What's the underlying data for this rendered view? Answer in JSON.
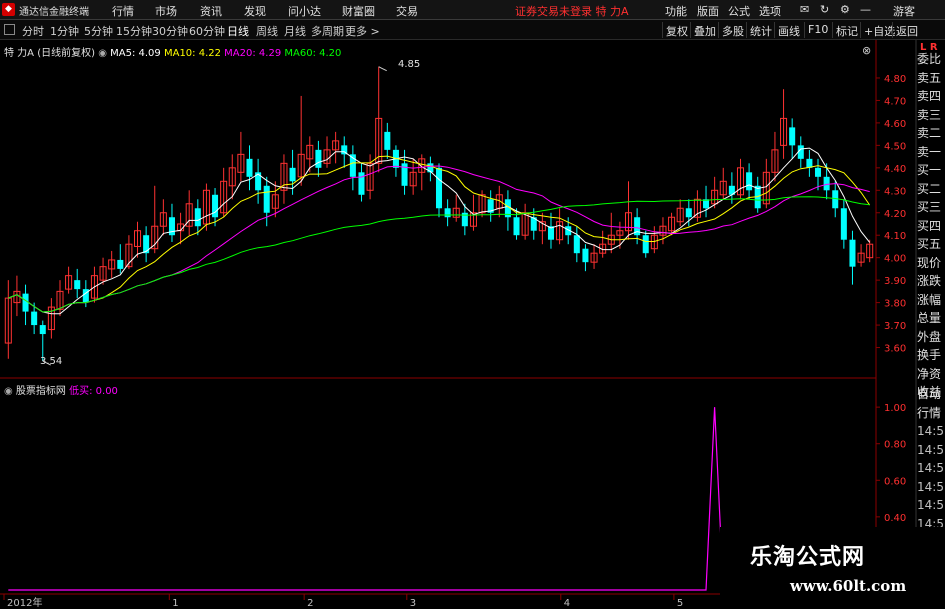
{
  "app": {
    "title": "通达信金融终端",
    "menu": [
      "行情",
      "市场",
      "资讯",
      "发现",
      "问小达",
      "财富圈",
      "交易"
    ],
    "login_status": "证券交易未登录",
    "stock_short": "特 力A",
    "right_menu": [
      "功能",
      "版面",
      "公式",
      "选项"
    ],
    "guest": "游客"
  },
  "periodbar": {
    "periods": [
      "分时",
      "1分钟",
      "5分钟",
      "15分钟",
      "30分钟",
      "60分钟",
      "日线",
      "周线",
      "月线",
      "多周期",
      "更多 >"
    ],
    "active_period": "日线",
    "tools": [
      "复权",
      "叠加",
      "多股",
      "统计",
      "画线",
      "F10",
      "标记",
      "+自选",
      "返回"
    ]
  },
  "legend_main": {
    "stock": "特 力A (日线前复权)",
    "ma5": "MA5: 4.09",
    "ma10": "MA10: 4.22",
    "ma20": "MA20: 4.29",
    "ma60": "MA60: 4.20"
  },
  "legend_sub": {
    "name": "股票指标网",
    "indicator": "低买: 0.00"
  },
  "annotations": {
    "high": "4.85",
    "low": "3.54"
  },
  "price_axis": [
    "4.80",
    "4.70",
    "4.60",
    "4.50",
    "4.40",
    "4.30",
    "4.20",
    "4.10",
    "4.00",
    "3.90",
    "3.80",
    "3.70",
    "3.60"
  ],
  "sub_axis": [
    "1.00",
    "0.80",
    "0.60",
    "0.40"
  ],
  "time_axis": [
    "2012年",
    "1",
    "2",
    "3",
    "4",
    "5"
  ],
  "side_panel": [
    "委比",
    "卖五",
    "卖四",
    "卖三",
    "卖二",
    "卖一",
    "买一",
    "买二",
    "买三",
    "买四",
    "买五",
    "现价",
    "涨跌",
    "涨幅",
    "总量",
    "外盘",
    "换手",
    "净资",
    "收益"
  ],
  "side_panel2": [
    "自动",
    "行情",
    "14:5",
    "14:5",
    "14:5",
    "14:5",
    "14:5",
    "14:5"
  ],
  "side_top": "L R",
  "watermark": {
    "line1": "乐淘公式网",
    "line2": "www.60lt.com"
  },
  "colors": {
    "up": "#ff3232",
    "down": "#00ffff",
    "ma5": "#ffffff",
    "ma10": "#ffff00",
    "ma20": "#ff00ff",
    "ma60": "#00ff00",
    "signal": "#ff00ff"
  },
  "chart_data": {
    "type": "candlestick",
    "price_range": [
      3.5,
      4.88
    ],
    "candles": [
      [
        3.62,
        3.82,
        3.9,
        3.55
      ],
      [
        3.8,
        3.85,
        3.92,
        3.74
      ],
      [
        3.84,
        3.76,
        3.88,
        3.7
      ],
      [
        3.76,
        3.7,
        3.8,
        3.66
      ],
      [
        3.7,
        3.66,
        3.72,
        3.54
      ],
      [
        3.68,
        3.78,
        3.82,
        3.64
      ],
      [
        3.77,
        3.85,
        3.9,
        3.74
      ],
      [
        3.86,
        3.92,
        3.96,
        3.84
      ],
      [
        3.9,
        3.86,
        3.95,
        3.82
      ],
      [
        3.86,
        3.8,
        3.9,
        3.78
      ],
      [
        3.82,
        3.92,
        3.96,
        3.8
      ],
      [
        3.9,
        3.96,
        4.0,
        3.88
      ],
      [
        3.95,
        3.99,
        4.03,
        3.91
      ],
      [
        3.99,
        3.95,
        4.06,
        3.93
      ],
      [
        3.96,
        4.06,
        4.1,
        3.95
      ],
      [
        4.05,
        4.12,
        4.16,
        4.0
      ],
      [
        4.1,
        4.02,
        4.14,
        3.98
      ],
      [
        4.04,
        4.14,
        4.32,
        4.02
      ],
      [
        4.14,
        4.2,
        4.26,
        4.1
      ],
      [
        4.18,
        4.1,
        4.24,
        4.07
      ],
      [
        4.12,
        4.15,
        4.2,
        4.06
      ],
      [
        4.14,
        4.24,
        4.3,
        4.1
      ],
      [
        4.22,
        4.14,
        4.26,
        4.1
      ],
      [
        4.15,
        4.3,
        4.33,
        4.12
      ],
      [
        4.28,
        4.18,
        4.31,
        4.14
      ],
      [
        4.2,
        4.34,
        4.4,
        4.18
      ],
      [
        4.32,
        4.4,
        4.46,
        4.26
      ],
      [
        4.38,
        4.46,
        4.56,
        4.34
      ],
      [
        4.44,
        4.36,
        4.5,
        4.3
      ],
      [
        4.38,
        4.3,
        4.44,
        4.24
      ],
      [
        4.32,
        4.2,
        4.36,
        4.14
      ],
      [
        4.22,
        4.28,
        4.34,
        4.18
      ],
      [
        4.3,
        4.42,
        4.46,
        4.24
      ],
      [
        4.4,
        4.34,
        4.48,
        4.28
      ],
      [
        4.36,
        4.46,
        4.72,
        4.32
      ],
      [
        4.44,
        4.5,
        4.54,
        4.38
      ],
      [
        4.48,
        4.4,
        4.52,
        4.36
      ],
      [
        4.42,
        4.48,
        4.54,
        4.4
      ],
      [
        4.48,
        4.52,
        4.56,
        4.42
      ],
      [
        4.5,
        4.46,
        4.54,
        4.4
      ],
      [
        4.46,
        4.36,
        4.5,
        4.3
      ],
      [
        4.38,
        4.28,
        4.42,
        4.25
      ],
      [
        4.3,
        4.42,
        4.46,
        4.26
      ],
      [
        4.42,
        4.62,
        4.85,
        4.38
      ],
      [
        4.56,
        4.48,
        4.6,
        4.44
      ],
      [
        4.48,
        4.4,
        4.5,
        4.36
      ],
      [
        4.42,
        4.32,
        4.48,
        4.28
      ],
      [
        4.32,
        4.38,
        4.44,
        4.28
      ],
      [
        4.38,
        4.44,
        4.46,
        4.3
      ],
      [
        4.42,
        4.38,
        4.45,
        4.34
      ],
      [
        4.4,
        4.22,
        4.42,
        4.18
      ],
      [
        4.22,
        4.18,
        4.26,
        4.14
      ],
      [
        4.18,
        4.22,
        4.28,
        4.16
      ],
      [
        4.2,
        4.14,
        4.24,
        4.1
      ],
      [
        4.14,
        4.2,
        4.28,
        4.12
      ],
      [
        4.2,
        4.28,
        4.3,
        4.18
      ],
      [
        4.26,
        4.2,
        4.3,
        4.16
      ],
      [
        4.22,
        4.28,
        4.32,
        4.18
      ],
      [
        4.26,
        4.18,
        4.3,
        4.12
      ],
      [
        4.18,
        4.1,
        4.22,
        4.08
      ],
      [
        4.1,
        4.2,
        4.24,
        4.08
      ],
      [
        4.18,
        4.12,
        4.22,
        4.08
      ],
      [
        4.12,
        4.16,
        4.2,
        4.06
      ],
      [
        4.14,
        4.08,
        4.2,
        4.04
      ],
      [
        4.08,
        4.16,
        4.22,
        4.06
      ],
      [
        4.14,
        4.1,
        4.18,
        4.06
      ],
      [
        4.1,
        4.02,
        4.14,
        3.98
      ],
      [
        4.04,
        3.98,
        4.06,
        3.94
      ],
      [
        3.98,
        4.02,
        4.06,
        3.95
      ],
      [
        4.02,
        4.06,
        4.12,
        4.0
      ],
      [
        4.06,
        4.1,
        4.2,
        4.02
      ],
      [
        4.1,
        4.12,
        4.16,
        4.04
      ],
      [
        4.12,
        4.2,
        4.34,
        4.08
      ],
      [
        4.18,
        4.1,
        4.22,
        4.06
      ],
      [
        4.1,
        4.02,
        4.12,
        4.0
      ],
      [
        4.04,
        4.1,
        4.14,
        4.02
      ],
      [
        4.1,
        4.14,
        4.18,
        4.06
      ],
      [
        4.12,
        4.18,
        4.2,
        4.1
      ],
      [
        4.16,
        4.22,
        4.26,
        4.14
      ],
      [
        4.22,
        4.18,
        4.26,
        4.14
      ],
      [
        4.18,
        4.26,
        4.3,
        4.16
      ],
      [
        4.26,
        4.22,
        4.32,
        4.18
      ],
      [
        4.24,
        4.3,
        4.36,
        4.22
      ],
      [
        4.28,
        4.34,
        4.4,
        4.26
      ],
      [
        4.32,
        4.28,
        4.38,
        4.24
      ],
      [
        4.28,
        4.4,
        4.44,
        4.26
      ],
      [
        4.38,
        4.3,
        4.42,
        4.26
      ],
      [
        4.32,
        4.22,
        4.36,
        4.2
      ],
      [
        4.24,
        4.38,
        4.44,
        4.22
      ],
      [
        4.38,
        4.48,
        4.56,
        4.34
      ],
      [
        4.5,
        4.62,
        4.75,
        4.44
      ],
      [
        4.58,
        4.5,
        4.62,
        4.44
      ],
      [
        4.5,
        4.44,
        4.54,
        4.4
      ],
      [
        4.44,
        4.4,
        4.48,
        4.36
      ],
      [
        4.4,
        4.36,
        4.44,
        4.3
      ],
      [
        4.36,
        4.3,
        4.42,
        4.26
      ],
      [
        4.3,
        4.22,
        4.34,
        4.18
      ],
      [
        4.22,
        4.08,
        4.26,
        4.04
      ],
      [
        4.08,
        3.96,
        4.12,
        3.88
      ],
      [
        3.98,
        4.02,
        4.06,
        3.96
      ],
      [
        4.0,
        4.06,
        4.08,
        3.98
      ]
    ],
    "signal_index": 82
  }
}
